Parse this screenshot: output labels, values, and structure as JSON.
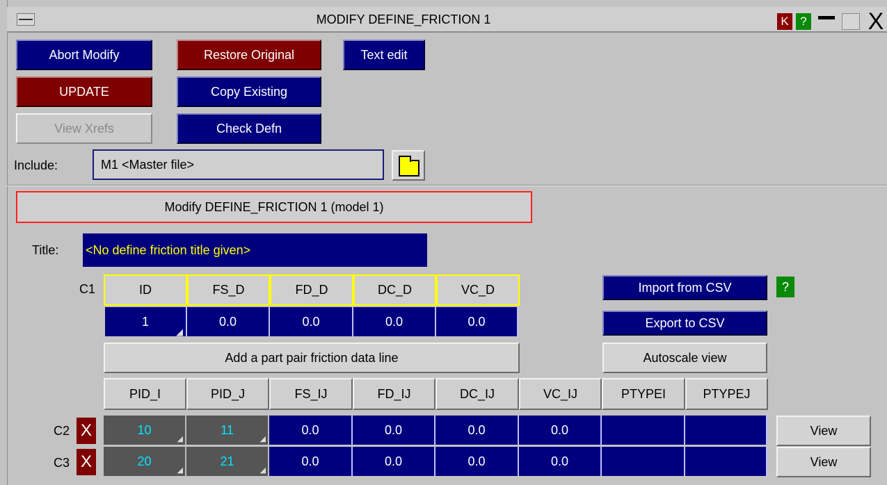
{
  "window": {
    "title": "MODIFY DEFINE_FRICTION 1",
    "k_label": "K",
    "help_label": "?",
    "close_label": "X"
  },
  "toolbar": {
    "abort": "Abort Modify",
    "restore": "Restore Original",
    "text_edit": "Text edit",
    "update": "UPDATE",
    "copy": "Copy Existing",
    "view_xrefs": "View Xrefs",
    "check": "Check Defn"
  },
  "include": {
    "label": "Include:",
    "value": "M1  <Master file>"
  },
  "modify_banner": "Modify DEFINE_FRICTION 1 (model 1)",
  "title_field": {
    "label": "Title:",
    "value": "<No define friction title given>"
  },
  "card1": {
    "row_label": "C1",
    "headers": [
      "ID",
      "FS_D",
      "FD_D",
      "DC_D",
      "VC_D"
    ],
    "values": [
      "1",
      "0.0",
      "0.0",
      "0.0",
      "0.0"
    ]
  },
  "side_buttons": {
    "import": "Import from CSV",
    "import_help": "?",
    "export": "Export to CSV",
    "autoscale": "Autoscale view"
  },
  "add_line": "Add a part pair friction data line",
  "pair_headers": [
    "PID_I",
    "PID_J",
    "FS_IJ",
    "FD_IJ",
    "DC_IJ",
    "VC_IJ",
    "PTYPEI",
    "PTYPEJ"
  ],
  "pair_rows": [
    {
      "label": "C2",
      "delete": "X",
      "values": [
        "10",
        "11",
        "0.0",
        "0.0",
        "0.0",
        "0.0",
        "",
        ""
      ],
      "view": "View"
    },
    {
      "label": "C3",
      "delete": "X",
      "values": [
        "20",
        "21",
        "0.0",
        "0.0",
        "0.0",
        "0.0",
        "",
        ""
      ],
      "view": "View"
    }
  ]
}
